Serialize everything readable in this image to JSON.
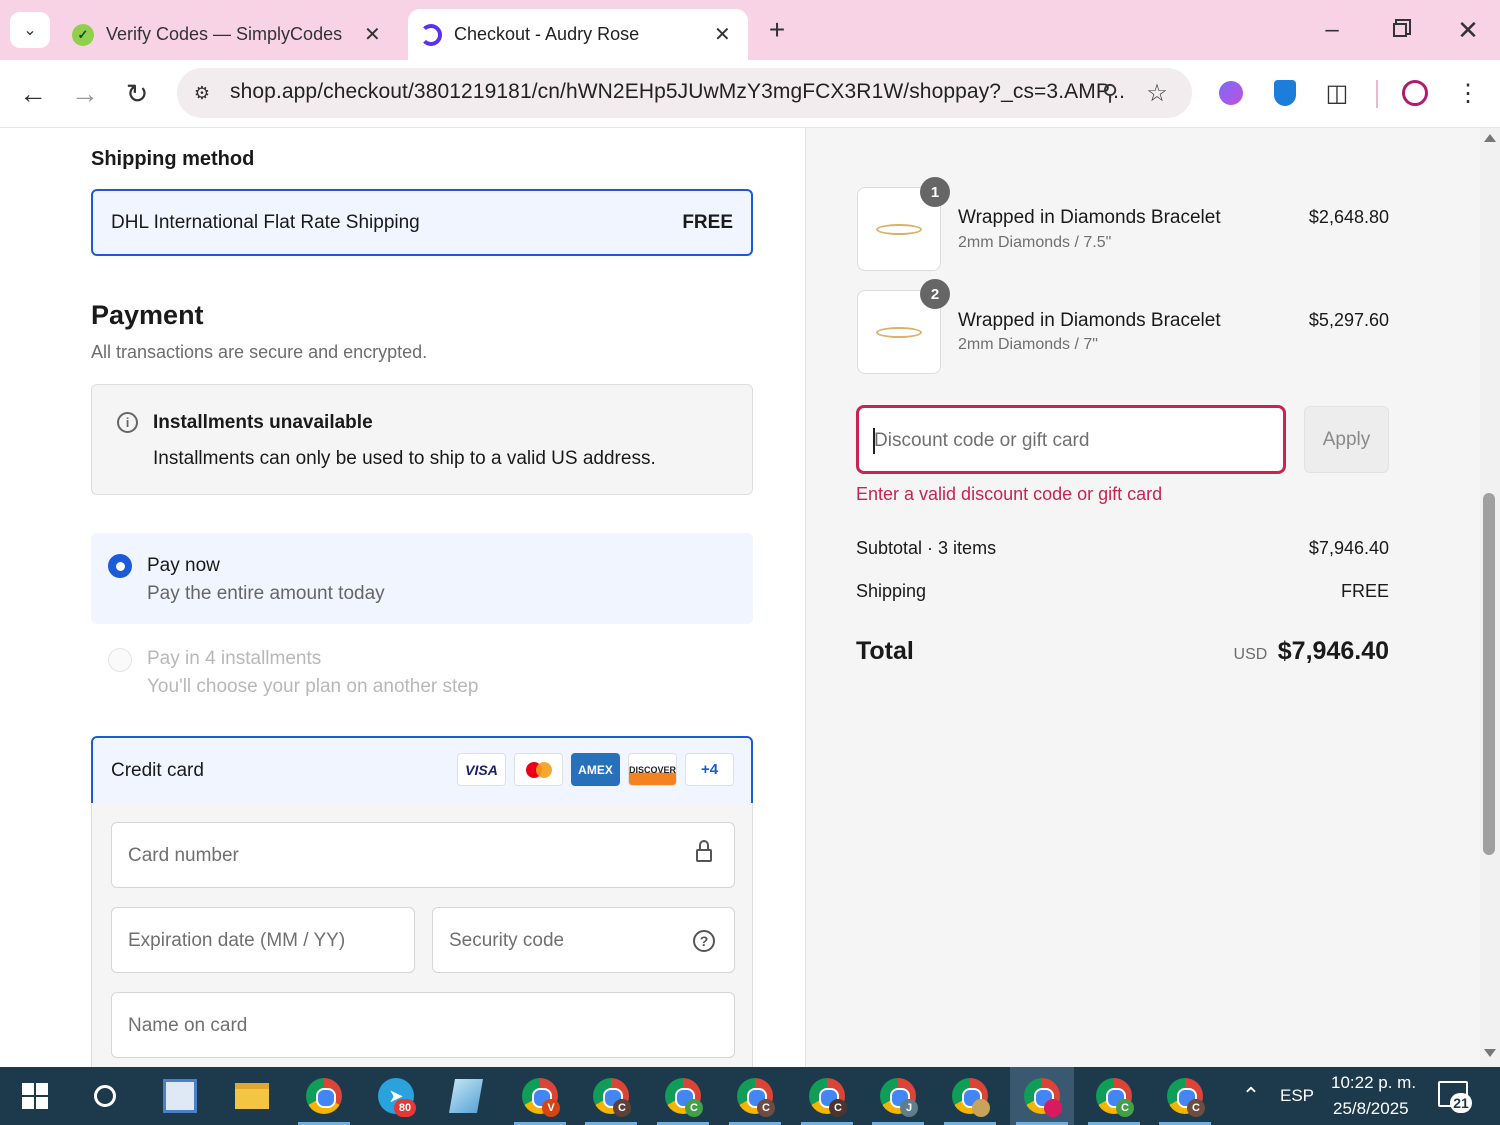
{
  "browser": {
    "tabs": [
      {
        "title": "Verify Codes — SimplyCodes"
      },
      {
        "title": "Checkout - Audry Rose"
      }
    ],
    "url": "shop.app/checkout/3801219181/cn/hWN2EHp5JUwMzY3mgFCX3R1W/shoppay?_cs=3.AMP..."
  },
  "shipping": {
    "heading": "Shipping method",
    "method": "DHL International Flat Rate Shipping",
    "price": "FREE"
  },
  "payment": {
    "heading": "Payment",
    "subtitle": "All transactions are secure and encrypted.",
    "notice_title": "Installments unavailable",
    "notice_text": "Installments can only be used to ship to a valid US address.",
    "option1_title": "Pay now",
    "option1_sub": "Pay the entire amount today",
    "option2_title": "Pay in 4 installments",
    "option2_sub": "You'll choose your plan on another step",
    "method_label": "Credit card",
    "card_logos": [
      "VISA",
      "AMEX",
      "DISCOVER"
    ],
    "more_cards": "+4",
    "card_number_ph": "Card number",
    "expiry_ph": "Expiration date (MM / YY)",
    "security_ph": "Security code",
    "name_ph": "Name on card"
  },
  "order": {
    "items": [
      {
        "qty": "1",
        "name": "Wrapped in Diamonds Bracelet",
        "variant": "2mm Diamonds / 7.5\"",
        "price": "$2,648.80"
      },
      {
        "qty": "2",
        "name": "Wrapped in Diamonds Bracelet",
        "variant": "2mm Diamonds / 7\"",
        "price": "$5,297.60"
      }
    ],
    "discount_ph": "Discount code or gift card",
    "apply_label": "Apply",
    "discount_error": "Enter a valid discount code or gift card",
    "subtotal_label": "Subtotal · 3 items",
    "subtotal_value": "$7,946.40",
    "shipping_label": "Shipping",
    "shipping_value": "FREE",
    "total_label": "Total",
    "currency": "USD",
    "total_value": "$7,946.40"
  },
  "taskbar": {
    "language": "ESP",
    "time": "10:22 p. m.",
    "date": "25/8/2025",
    "notifications": "21",
    "telegram_badge": "80"
  },
  "colors": {
    "tabbar_bg": "#f8d3e6",
    "accent_blue": "#1c5bd8",
    "error": "#c8244e",
    "taskbar_bg": "#1c3a4c"
  }
}
